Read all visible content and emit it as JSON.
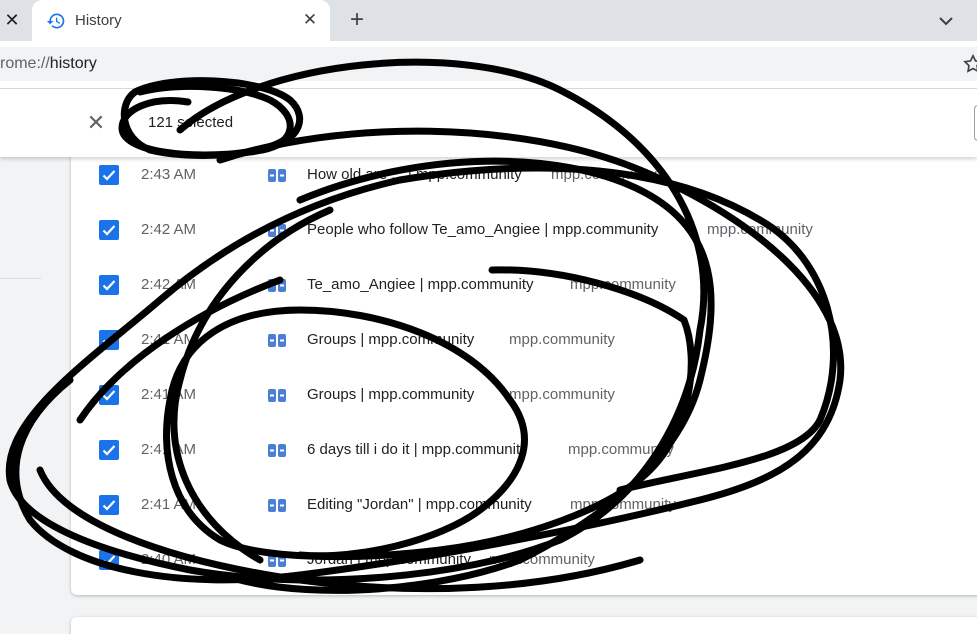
{
  "tabs": [
    {
      "title": "History",
      "active": true
    }
  ],
  "toolbar": {
    "url_scheme": "rome://",
    "url_path": "history"
  },
  "selection": {
    "count_label": "121 selected"
  },
  "history": [
    {
      "time": "2:43 AM",
      "title": "How old are ... | mpp.community",
      "domain": "mpp.community"
    },
    {
      "time": "2:42 AM",
      "title": "People who follow Te_amo_Angiee | mpp.community",
      "domain": "mpp.community"
    },
    {
      "time": "2:42 AM",
      "title": "Te_amo_Angiee | mpp.community",
      "domain": "mpp.community"
    },
    {
      "time": "2:41 AM",
      "title": "Groups | mpp.community",
      "domain": "mpp.community"
    },
    {
      "time": "2:41 AM",
      "title": "Groups | mpp.community",
      "domain": "mpp.community"
    },
    {
      "time": "2:41 AM",
      "title": "6 days till i do it | mpp.community",
      "domain": "mpp.community"
    },
    {
      "time": "2:41 AM",
      "title": "Editing \"Jordan\" | mpp.community",
      "domain": "mpp.community"
    },
    {
      "time": "2:40 AM",
      "title": "Jordan | mpp.community",
      "domain": "mpp.community"
    }
  ],
  "colors": {
    "accent": "#1a73e8",
    "favicon": "#4a7fd4",
    "scribble": "#000000"
  }
}
